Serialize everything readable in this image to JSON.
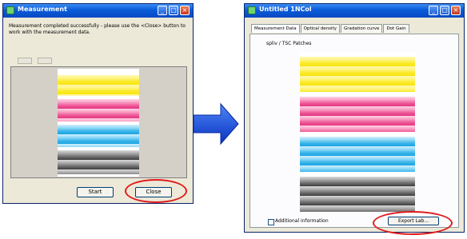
{
  "left_window": {
    "title": "Measurement",
    "message": "Measurement completed successfully - please use the <Close> button to work with the measurement data.",
    "start_label": "Start",
    "close_label": "Close"
  },
  "right_window": {
    "title": "Untitled 1NCol",
    "tabs": [
      "Measurement Data",
      "Optical density",
      "Gradation curve",
      "Dot Gain"
    ],
    "active_tab": 0,
    "chart_label": "spliv / TSC Patches",
    "additional_info_label": "Additional information",
    "export_label": "Export Lab..."
  },
  "colors": {
    "highlight_ring": "#e01a1a",
    "arrow": "#1f4fe0",
    "titlebar": "#0a5bd8"
  }
}
